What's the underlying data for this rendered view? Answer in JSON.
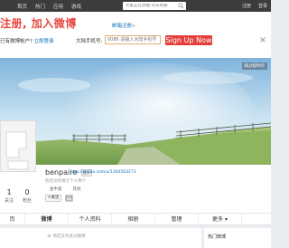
{
  "topbar": {
    "nav": [
      "",
      "首页",
      "热门",
      "应用",
      "游戏"
    ],
    "search_placeholder": "大家正在热搜:可乐有朋",
    "right_links": [
      "注册",
      "登录"
    ]
  },
  "register": {
    "slogan": "注册, 加入微博",
    "email_register": "邮箱注册»",
    "login_prompt_prefix": "已有微博帐户?",
    "login_prompt_link": "立即登录",
    "phone_label": "大陆手机号:",
    "phone_placeholder": "0086 请输入大陆手机号",
    "signup_label": "Sign Up Now"
  },
  "cover": {
    "tag_text": "踩过程时的"
  },
  "profile": {
    "username": "benpaire",
    "badge": "达人",
    "url": "http://weibo.com/u/1164563273",
    "bio": "他还没有填写个人简介",
    "meta": [
      "金牛座",
      "其他"
    ],
    "follow_label": "+关注",
    "stats": [
      {
        "num": "1",
        "label": "关注"
      },
      {
        "num": "0",
        "label": "粉丝"
      }
    ]
  },
  "tabs": [
    "页",
    "微博",
    "个人资料",
    "相册",
    "管理",
    "更多 ▾"
  ],
  "feed": {
    "item_text": "他还没有发过微博"
  },
  "side": {
    "title": "热门微博"
  },
  "colors": {
    "accent_red": "#e43f3a",
    "link_blue": "#0a70b8",
    "topbar": "#3c3c3c"
  }
}
